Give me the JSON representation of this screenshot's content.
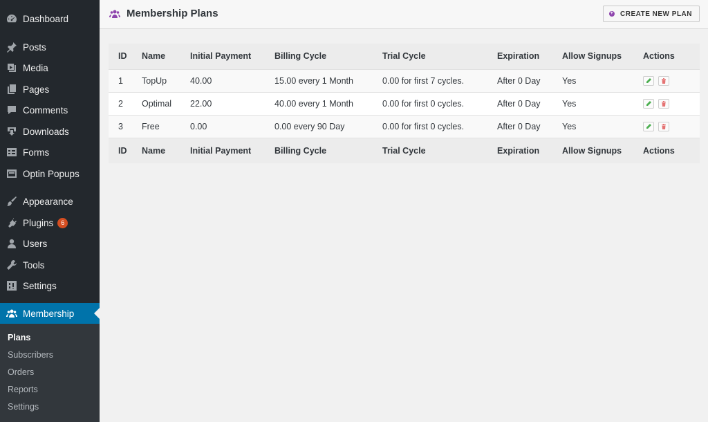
{
  "sidebar": {
    "items": [
      {
        "label": "Dashboard",
        "icon": "dashboard-icon"
      },
      {
        "label": "Posts",
        "icon": "pushpin-icon"
      },
      {
        "label": "Media",
        "icon": "media-icon"
      },
      {
        "label": "Pages",
        "icon": "pages-icon"
      },
      {
        "label": "Comments",
        "icon": "comment-icon"
      },
      {
        "label": "Downloads",
        "icon": "download-icon"
      },
      {
        "label": "Forms",
        "icon": "forms-icon"
      },
      {
        "label": "Optin Popups",
        "icon": "popup-icon"
      },
      {
        "label": "Appearance",
        "icon": "paintbrush-icon"
      },
      {
        "label": "Plugins",
        "icon": "plugin-icon",
        "badge": "6"
      },
      {
        "label": "Users",
        "icon": "user-icon"
      },
      {
        "label": "Tools",
        "icon": "wrench-icon"
      },
      {
        "label": "Settings",
        "icon": "settings-icon"
      },
      {
        "label": "Membership",
        "icon": "group-icon"
      }
    ],
    "submenu": [
      "Plans",
      "Subscribers",
      "Orders",
      "Reports",
      "Settings"
    ]
  },
  "header": {
    "title": "Membership Plans",
    "create_button": "CREATE NEW PLAN"
  },
  "table": {
    "columns": [
      "ID",
      "Name",
      "Initial Payment",
      "Billing Cycle",
      "Trial Cycle",
      "Expiration",
      "Allow Signups",
      "Actions"
    ],
    "rows": [
      [
        "1",
        "TopUp",
        "40.00",
        "15.00 every 1 Month",
        "0.00 for first 7 cycles.",
        "After 0 Day",
        "Yes"
      ],
      [
        "2",
        "Optimal",
        "22.00",
        "40.00 every 1 Month",
        "0.00 for first 0 cycles.",
        "After 0 Day",
        "Yes"
      ],
      [
        "3",
        "Free",
        "0.00",
        "0.00 every 90 Day",
        "0.00 for first 0 cycles.",
        "After 0 Day",
        "Yes"
      ]
    ]
  },
  "colors": {
    "sidebar_bg": "#23282d",
    "submenu_bg": "#32373c",
    "active_bg": "#0073aa",
    "badge": "#d54e21",
    "accent_purple": "#8e44ad",
    "edit_green": "#4caf50",
    "delete_red": "#e57373"
  }
}
